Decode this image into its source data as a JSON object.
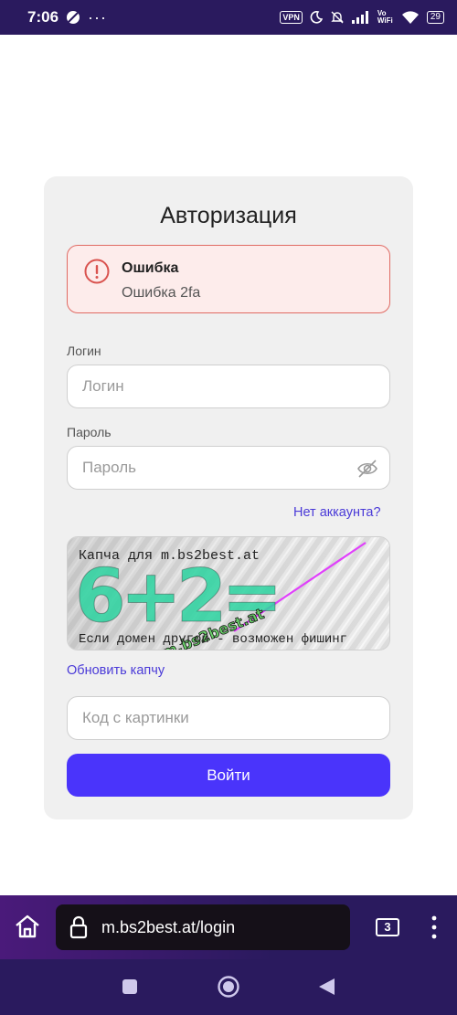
{
  "status_bar": {
    "time": "7:06",
    "notif_dots": "···",
    "vpn": "VPN",
    "volte": "Vo WiFi",
    "battery": "29"
  },
  "form": {
    "title": "Авторизация",
    "alert": {
      "title": "Ошибка",
      "message": "Ошибка 2fa"
    },
    "login_label": "Логин",
    "login_placeholder": "Логин",
    "password_label": "Пароль",
    "password_placeholder": "Пароль",
    "no_account_link": "Нет аккаунта?",
    "captcha": {
      "top_text": "Капча для m.bs2best.at",
      "expression": "6+2=",
      "stamp": "m.bs2best.at",
      "bottom_text": "Если домен другой - возможен фишинг"
    },
    "refresh_captcha_link": "Обновить капчу",
    "captcha_placeholder": "Код с картинки",
    "submit_label": "Войти"
  },
  "browser": {
    "url": "m.bs2best.at/login",
    "tab_count": "3"
  },
  "colors": {
    "accent": "#4a34fb",
    "link": "#4a3ad8",
    "error_border": "#e06a63",
    "error_bg": "#fdeceb",
    "system_bar": "#2a1a5e"
  }
}
